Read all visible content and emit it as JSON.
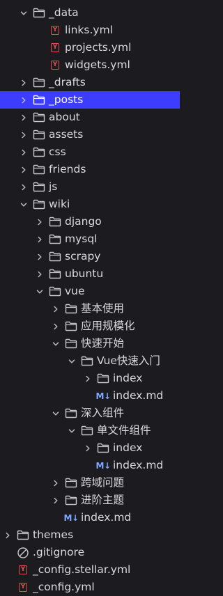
{
  "colors": {
    "background": "#1b1b20",
    "selection": "#3d3dff",
    "text": "#dadade",
    "folder_icon": "#c8c8cc",
    "yml_icon": "#e05050",
    "md_icon": "#7fa8ff"
  },
  "icons": {
    "markdown_glyph": "M↓",
    "yml_glyph": "Y"
  },
  "rows": [
    {
      "label": "_data",
      "type": "folder",
      "state": "expanded",
      "depth": 2,
      "icon": "folder-icon"
    },
    {
      "label": "links.yml",
      "type": "yml",
      "depth": 3,
      "icon": "yaml-file-icon"
    },
    {
      "label": "projects.yml",
      "type": "yml",
      "depth": 3,
      "icon": "yaml-file-icon"
    },
    {
      "label": "widgets.yml",
      "type": "yml",
      "depth": 3,
      "icon": "yaml-file-icon"
    },
    {
      "label": "_drafts",
      "type": "folder",
      "state": "collapsed",
      "depth": 2,
      "icon": "folder-icon"
    },
    {
      "label": "_posts",
      "type": "folder",
      "state": "collapsed",
      "depth": 2,
      "icon": "folder-icon",
      "selected": true
    },
    {
      "label": "about",
      "type": "folder",
      "state": "collapsed",
      "depth": 2,
      "icon": "folder-icon"
    },
    {
      "label": "assets",
      "type": "folder",
      "state": "collapsed",
      "depth": 2,
      "icon": "folder-icon"
    },
    {
      "label": "css",
      "type": "folder",
      "state": "collapsed",
      "depth": 2,
      "icon": "folder-icon"
    },
    {
      "label": "friends",
      "type": "folder",
      "state": "collapsed",
      "depth": 2,
      "icon": "folder-icon"
    },
    {
      "label": "js",
      "type": "folder",
      "state": "collapsed",
      "depth": 2,
      "icon": "folder-icon"
    },
    {
      "label": "wiki",
      "type": "folder",
      "state": "expanded",
      "depth": 2,
      "icon": "folder-icon"
    },
    {
      "label": "django",
      "type": "folder",
      "state": "collapsed",
      "depth": 3,
      "icon": "folder-icon"
    },
    {
      "label": "mysql",
      "type": "folder",
      "state": "collapsed",
      "depth": 3,
      "icon": "folder-icon"
    },
    {
      "label": "scrapy",
      "type": "folder",
      "state": "collapsed",
      "depth": 3,
      "icon": "folder-icon"
    },
    {
      "label": "ubuntu",
      "type": "folder",
      "state": "collapsed",
      "depth": 3,
      "icon": "folder-icon"
    },
    {
      "label": "vue",
      "type": "folder",
      "state": "expanded",
      "depth": 3,
      "icon": "folder-icon"
    },
    {
      "label": "基本使用",
      "type": "folder",
      "state": "collapsed",
      "depth": 4,
      "icon": "folder-icon"
    },
    {
      "label": "应用规模化",
      "type": "folder",
      "state": "collapsed",
      "depth": 4,
      "icon": "folder-icon"
    },
    {
      "label": "快速开始",
      "type": "folder",
      "state": "expanded",
      "depth": 4,
      "icon": "folder-icon"
    },
    {
      "label": "Vue快速入门",
      "type": "folder",
      "state": "expanded",
      "depth": 5,
      "icon": "folder-icon"
    },
    {
      "label": "index",
      "type": "folder",
      "state": "collapsed",
      "depth": 6,
      "icon": "folder-icon"
    },
    {
      "label": "index.md",
      "type": "md",
      "depth": 6,
      "icon": "markdown-file-icon"
    },
    {
      "label": "深入组件",
      "type": "folder",
      "state": "expanded",
      "depth": 4,
      "icon": "folder-icon"
    },
    {
      "label": "单文件组件",
      "type": "folder",
      "state": "expanded",
      "depth": 5,
      "icon": "folder-icon"
    },
    {
      "label": "index",
      "type": "folder",
      "state": "collapsed",
      "depth": 6,
      "icon": "folder-icon"
    },
    {
      "label": "index.md",
      "type": "md",
      "depth": 6,
      "icon": "markdown-file-icon"
    },
    {
      "label": "跨域问题",
      "type": "folder",
      "state": "collapsed",
      "depth": 4,
      "icon": "folder-icon"
    },
    {
      "label": "进阶主题",
      "type": "folder",
      "state": "collapsed",
      "depth": 4,
      "icon": "folder-icon"
    },
    {
      "label": "index.md",
      "type": "md",
      "depth": 4,
      "icon": "markdown-file-icon"
    },
    {
      "label": "themes",
      "type": "folder",
      "state": "collapsed",
      "depth": 1,
      "icon": "folder-icon"
    },
    {
      "label": ".gitignore",
      "type": "ignore",
      "depth": 1,
      "icon": "gitignore-file-icon"
    },
    {
      "label": "_config.stellar.yml",
      "type": "yml",
      "depth": 1,
      "icon": "yaml-file-icon"
    },
    {
      "label": "_config.yml",
      "type": "yml",
      "depth": 1,
      "icon": "yaml-file-icon"
    }
  ]
}
